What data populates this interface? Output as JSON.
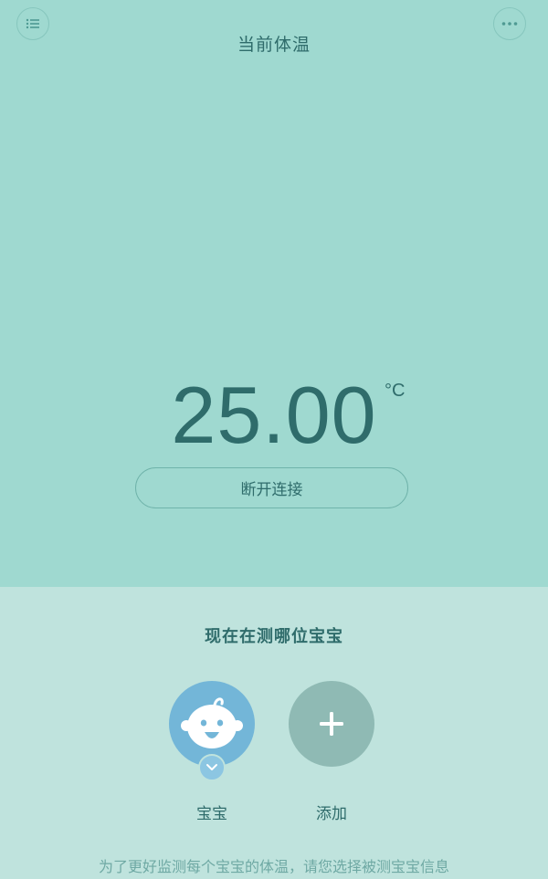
{
  "header": {
    "title": "当前体温",
    "menu_icon": "list-menu-icon",
    "more_icon": "more-dots-icon"
  },
  "temperature": {
    "value": "25.00",
    "unit": "°C"
  },
  "actions": {
    "disconnect_label": "断开连接"
  },
  "baby_select": {
    "prompt": "现在在测哪位宝宝",
    "babies": [
      {
        "label": "宝宝",
        "selected": true,
        "icon": "baby-face-icon"
      }
    ],
    "add_label": "添加",
    "add_icon": "plus-icon",
    "hint": "为了更好监测每个宝宝的体温，请您选择被测宝宝信息"
  },
  "colors": {
    "top_background": "#9fd9d0",
    "bottom_background": "#bfe3dd",
    "primary_text": "#2f6c6b",
    "baby_avatar": "#73b6d8",
    "add_avatar": "#8fbab4"
  }
}
